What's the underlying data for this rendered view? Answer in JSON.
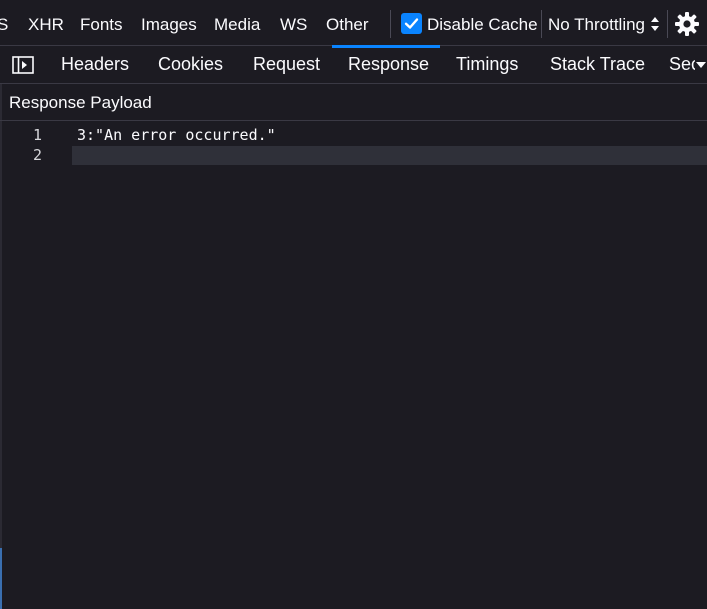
{
  "filters": {
    "partial_label": "S",
    "xhr": "XHR",
    "fonts": "Fonts",
    "images": "Images",
    "media": "Media",
    "ws": "WS",
    "other": "Other"
  },
  "cache": {
    "disable_cache_label": "Disable Cache",
    "checked": true
  },
  "throttling": {
    "selected": "No Throttling"
  },
  "tabs": [
    {
      "label": "Headers",
      "active": false
    },
    {
      "label": "Cookies",
      "active": false
    },
    {
      "label": "Request",
      "active": false
    },
    {
      "label": "Response",
      "active": true
    },
    {
      "label": "Timings",
      "active": false
    },
    {
      "label": "Stack Trace",
      "active": false
    },
    {
      "label": "Sec",
      "active": false
    }
  ],
  "section": {
    "title": "Response Payload"
  },
  "editor": {
    "lines": [
      {
        "number": "1",
        "text": "3:\"An error occurred.\""
      },
      {
        "number": "2",
        "text": ""
      }
    ],
    "current_line": 2
  },
  "icons": {
    "sidebar_toggle": "sidebar-toggle-icon",
    "checkbox": "checkmark-icon",
    "select_arrows": "up-down-arrows-icon",
    "settings": "gear-icon",
    "overflow": "chevron-down-icon"
  },
  "colors": {
    "accent": "#0a84ff",
    "background": "#1c1b22",
    "current_line": "#2f3039"
  }
}
